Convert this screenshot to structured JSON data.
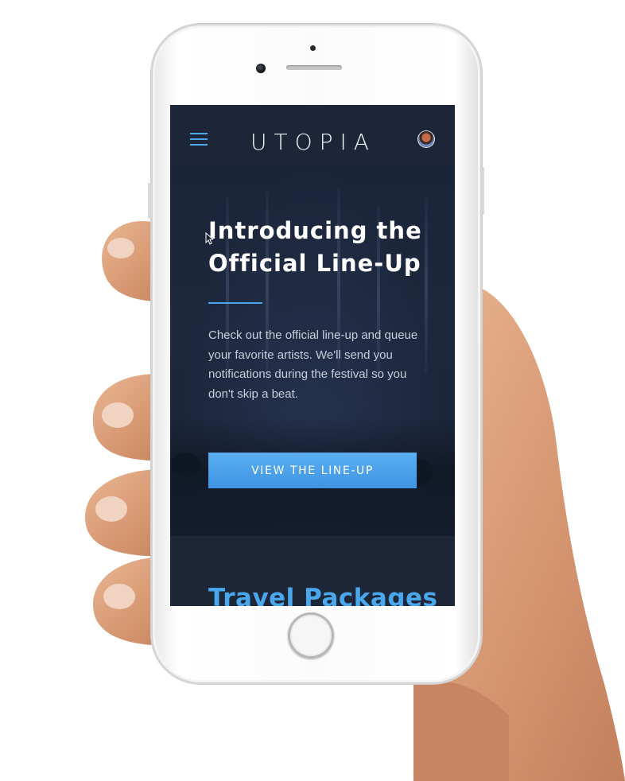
{
  "header": {
    "logo_text": "UTOPIA",
    "menu_icon": "hamburger-menu-icon",
    "avatar_icon": "user-avatar"
  },
  "hero": {
    "title_line1": "Introducing the",
    "title_line2": "Official Line-Up",
    "description": "Check out the official line-up and queue your favorite artists. We'll send you notifications during the festival so you don't skip a beat.",
    "cta_label": "VIEW THE LINE-UP"
  },
  "next_section": {
    "title": "Travel Packages"
  },
  "colors": {
    "accent": "#4aa7ec",
    "background": "#1a2539",
    "button": "#4a9fea"
  }
}
